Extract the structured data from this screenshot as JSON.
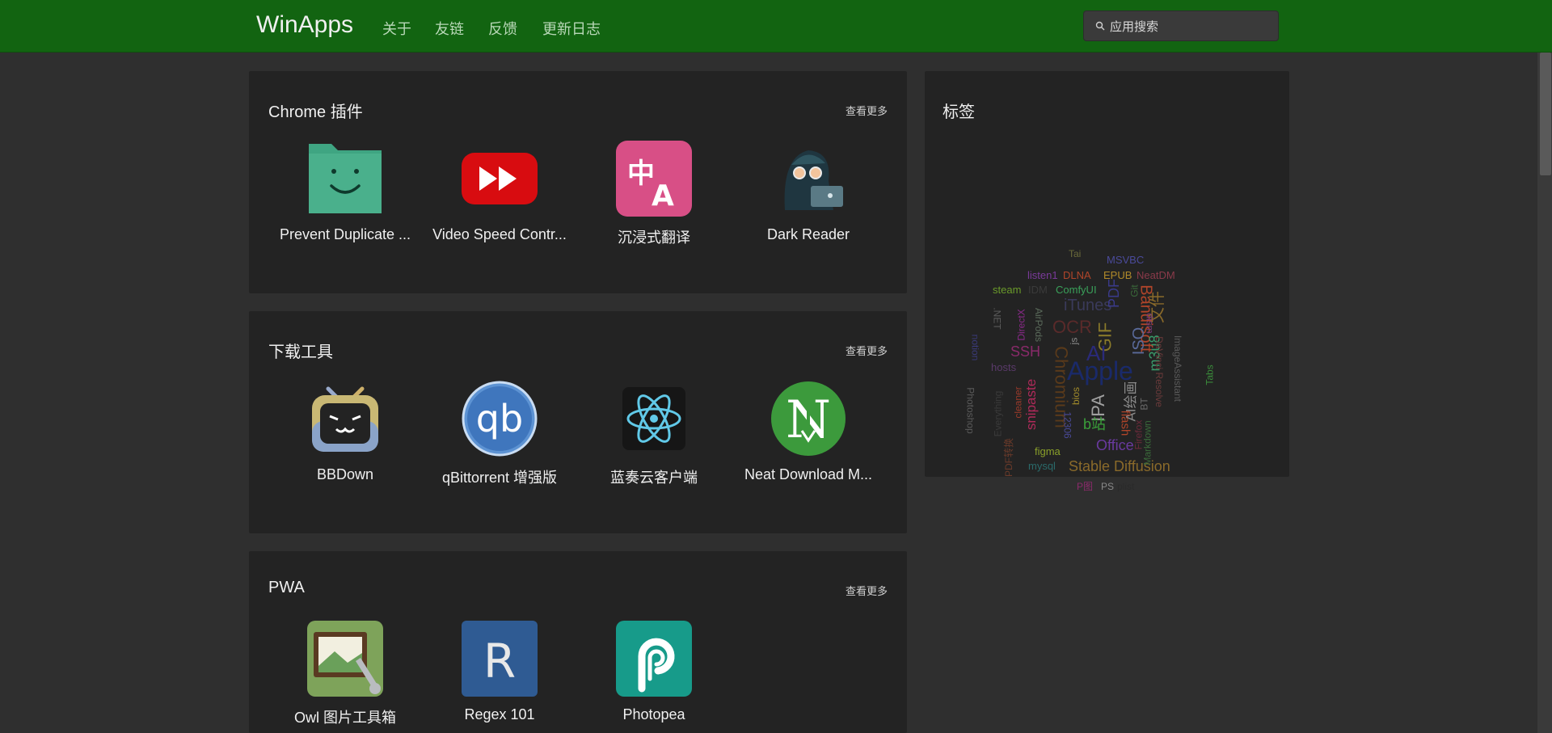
{
  "nav": {
    "brand": "WinApps",
    "links": [
      "关于",
      "友链",
      "反馈",
      "更新日志"
    ],
    "search_placeholder": "应用搜索"
  },
  "sections": [
    {
      "title": "Chrome 插件",
      "more": "查看更多",
      "apps": [
        {
          "name": "Prevent Duplicate ...",
          "icon": "folder-smile-icon"
        },
        {
          "name": "Video Speed Contr...",
          "icon": "fast-forward-icon"
        },
        {
          "name": "沉浸式翻译",
          "icon": "translate-icon"
        },
        {
          "name": "Dark Reader",
          "icon": "dark-reader-icon"
        }
      ]
    },
    {
      "title": "下载工具",
      "more": "查看更多",
      "apps": [
        {
          "name": "BBDown",
          "icon": "bilibili-tv-icon"
        },
        {
          "name": "qBittorrent 增强版",
          "icon": "qbittorrent-icon"
        },
        {
          "name": "蓝奏云客户端",
          "icon": "react-atom-icon"
        },
        {
          "name": "Neat Download M...",
          "icon": "neat-download-icon"
        }
      ]
    },
    {
      "title": "PWA",
      "more": "查看更多",
      "apps": [
        {
          "name": "Owl 图片工具箱",
          "icon": "image-tool-icon"
        },
        {
          "name": "Regex 101",
          "icon": "regex-icon"
        },
        {
          "name": "Photopea",
          "icon": "photopea-icon"
        }
      ]
    }
  ],
  "tags": {
    "title": "标签",
    "words": [
      {
        "text": "Tai",
        "color": "#6b6b3a"
      },
      {
        "text": "MSVBC",
        "color": "#4a4a9a"
      },
      {
        "text": "listen1",
        "color": "#7a3a9a"
      },
      {
        "text": "DLNA",
        "color": "#b0452a"
      },
      {
        "text": "EPUB",
        "color": "#b08a2a"
      },
      {
        "text": "NeatDM",
        "color": "#8a3a4a"
      },
      {
        "text": "steam",
        "color": "#6a9a2a"
      },
      {
        "text": "IDM",
        "color": "#3a3a3a"
      },
      {
        "text": "ComfyUI",
        "color": "#3aa05a"
      },
      {
        "text": "iTunes",
        "color": "#3a3a5a"
      },
      {
        "text": "PDF",
        "color": "#3a3a8a"
      },
      {
        "text": "Bandisoft",
        "color": "#b0452a"
      },
      {
        "text": "文件",
        "color": "#8a6a2a"
      },
      {
        "text": "OCR",
        "color": "#5a2a2a"
      },
      {
        "text": "SSH",
        "color": "#8a2a6a"
      },
      {
        "text": "Chromium",
        "color": "#5a3a1a"
      },
      {
        "text": "GIF",
        "color": "#8a7a2a"
      },
      {
        "text": "ISO",
        "color": "#5a6a9a"
      },
      {
        "text": "m3u8",
        "color": "#3a9a6a"
      },
      {
        "text": "Apple",
        "color": "#1a2a6a"
      },
      {
        "text": "AI",
        "color": "#2a2a7a"
      },
      {
        "text": "hosts",
        "color": "#5a3a6a"
      },
      {
        "text": "snipaste",
        "color": "#b02a5a"
      },
      {
        "text": "IPA",
        "color": "#a0a0a0"
      },
      {
        "text": "AI绘画",
        "color": "#8a8a8a"
      },
      {
        "text": "flash",
        "color": "#b0452a"
      },
      {
        "text": "b站",
        "color": "#3aa03a"
      },
      {
        "text": "Office",
        "color": "#6a3aa0"
      },
      {
        "text": "figma",
        "color": "#8aa02a"
      },
      {
        "text": "mysql",
        "color": "#2a6a6a"
      },
      {
        "text": "Stable Diffusion",
        "color": "#8a6a2a"
      },
      {
        "text": "P图",
        "color": "#8a2a6a"
      },
      {
        "text": "PS",
        "color": "#8a8a8a"
      },
      {
        "text": "plist",
        "color": "#2a2a2a"
      },
      {
        "text": "bios",
        "color": "#a08a2a"
      },
      {
        "text": "12306",
        "color": "#4a4a9a"
      },
      {
        "text": "cleaner",
        "color": "#9a3a2a"
      },
      {
        "text": "Everything",
        "color": "#3a3a3a"
      },
      {
        "text": "Photoshop",
        "color": "#5a5a5a"
      },
      {
        "text": "PDF转换",
        "color": "#6a3a2a"
      },
      {
        "text": ".NET",
        "color": "#5a5a5a"
      },
      {
        "text": "AirPods",
        "color": "#5a6a5a"
      },
      {
        "text": "DirectX",
        "color": "#8a2a8a"
      },
      {
        "text": "notion",
        "color": "#3a3a7a"
      },
      {
        "text": "Git",
        "color": "#3a6a3a"
      },
      {
        "text": "dism",
        "color": "#7a3a7a"
      },
      {
        "text": "Markdown",
        "color": "#3a6a3a"
      },
      {
        "text": "DaVinci Resolve",
        "color": "#6a3a3a"
      },
      {
        "text": "ImageAssistant",
        "color": "#5a5a5a"
      },
      {
        "text": "Tabs",
        "color": "#3a8a3a"
      },
      {
        "text": "Firefox",
        "color": "#6a2a3a"
      },
      {
        "text": "BT",
        "color": "#6a6a6a"
      },
      {
        "text": "js",
        "color": "#8a8a8a"
      }
    ]
  }
}
